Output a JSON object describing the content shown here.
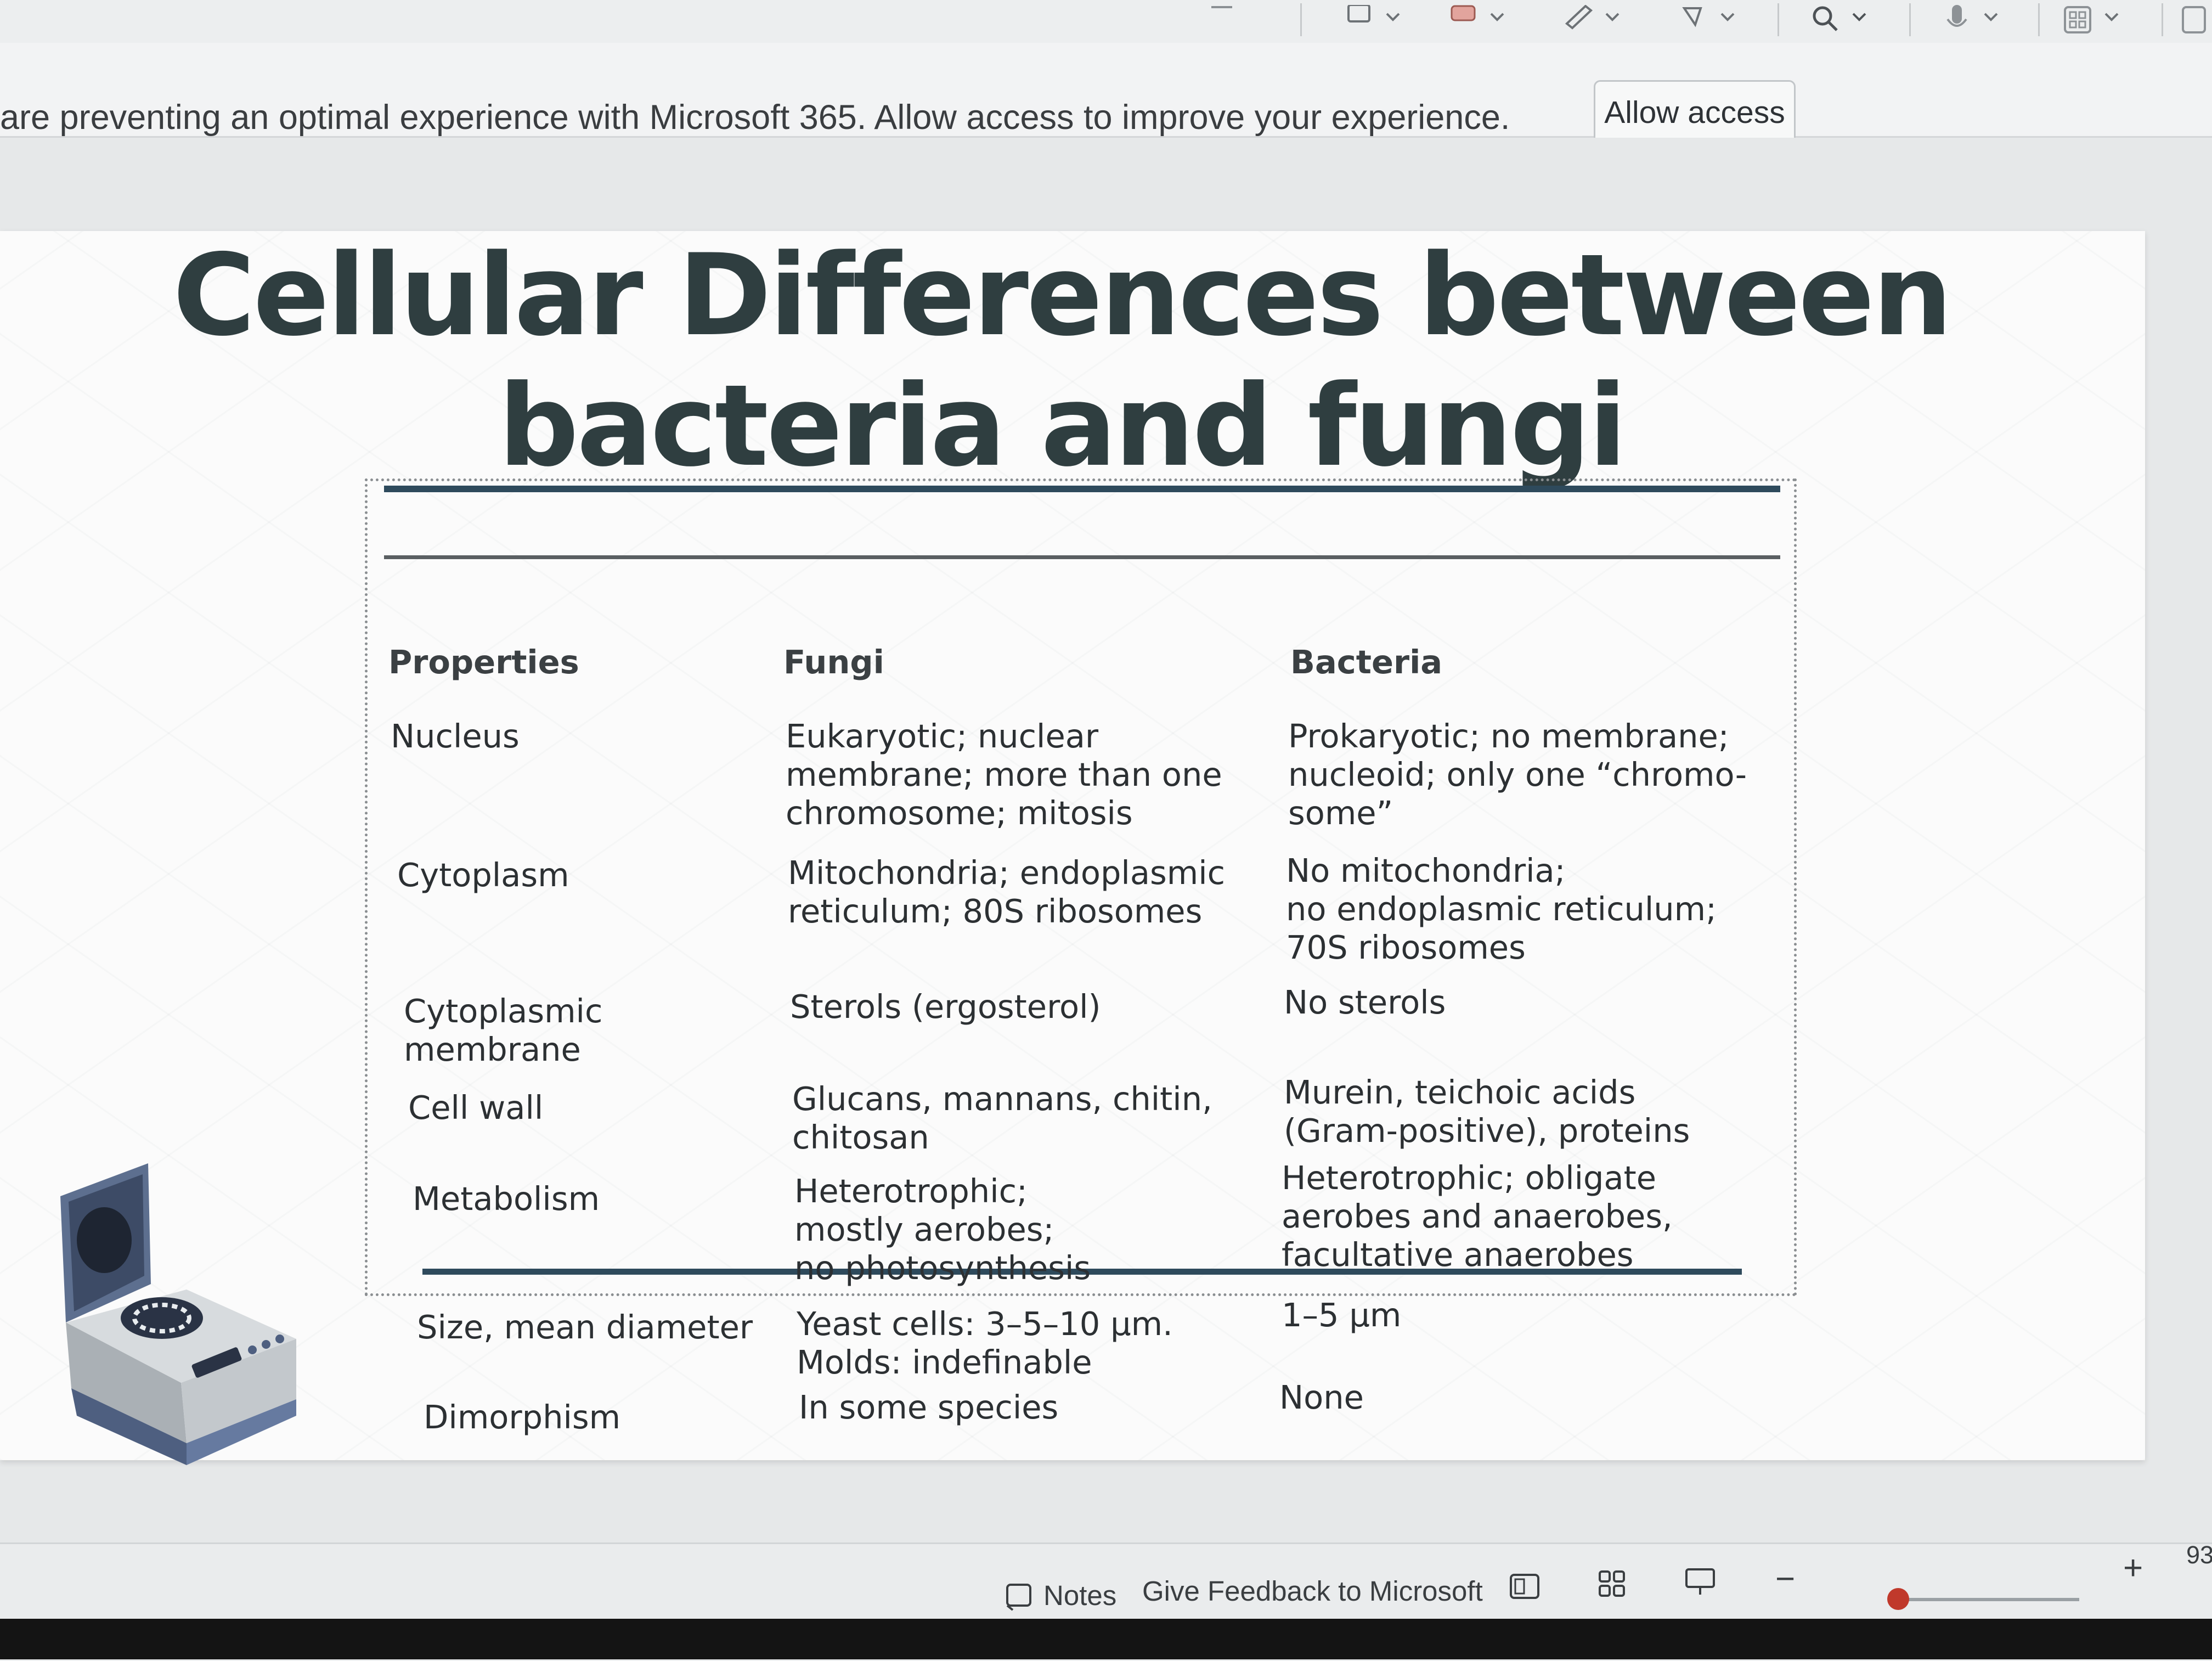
{
  "infobar": {
    "message": "are preventing an optimal experience with Microsoft 365. Allow access to improve your experience.",
    "allow_label": "Allow access"
  },
  "slide": {
    "title_line1": "Cellular Differences between",
    "title_line2": "bacteria and fungi",
    "table": {
      "headers": [
        "Properties",
        "Fungi",
        "Bacteria"
      ],
      "rows": [
        {
          "property": "Nucleus",
          "fungi": "Eukaryotic; nuclear\nmembrane; more than one\nchromosome; mitosis",
          "bacteria": "Prokaryotic; no membrane;\nnucleoid; only one “chromo-\nsome”"
        },
        {
          "property": "Cytoplasm",
          "fungi": "Mitochondria; endoplasmic\nreticulum; 80S ribosomes",
          "bacteria": "No mitochondria;\nno endoplasmic reticulum;\n70S ribosomes"
        },
        {
          "property": "Cytoplasmic\nmembrane",
          "fungi": "Sterols (ergosterol)",
          "bacteria": "No sterols"
        },
        {
          "property": "Cell wall",
          "fungi": "Glucans, mannans, chitin,\nchitosan",
          "bacteria": "Murein, teichoic acids\n(Gram-positive), proteins"
        },
        {
          "property": "Metabolism",
          "fungi": "Heterotrophic;\nmostly aerobes;\nno photosynthesis",
          "bacteria": "Heterotrophic; obligate\naerobes and anaerobes,\nfacultative anaerobes"
        },
        {
          "property": "Size, mean diameter",
          "fungi": "Yeast cells: 3–5–10 µm.\nMolds: indefinable",
          "bacteria": "1–5 µm"
        },
        {
          "property": "Dimorphism",
          "fungi": "In some species",
          "bacteria": "None"
        }
      ]
    }
  },
  "statusbar": {
    "notes_label": "Notes",
    "feedback_label": "Give Feedback to Microsoft",
    "zoom_minus": "−",
    "zoom_plus": "+",
    "zoom_value": "93",
    "zoom_level": 0.12
  },
  "toolbar_icons": [
    "rectangle-icon",
    "shape-icon",
    "pen-icon",
    "laser-pointer-icon",
    "search-icon",
    "microphone-icon",
    "layout-icon"
  ]
}
